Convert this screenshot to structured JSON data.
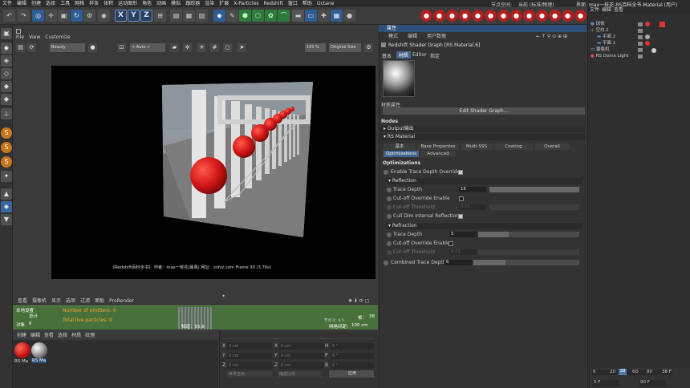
{
  "menu": [
    "文件",
    "编辑",
    "创建",
    "选择",
    "工具",
    "网格",
    "样条",
    "体积",
    "运动图形",
    "角色",
    "动画",
    "模拟",
    "跟踪器",
    "渲染",
    "扩展",
    "X-Particles",
    "Redshift",
    "窗口",
    "帮助",
    "Octane"
  ],
  "node_space_label": "节点空间:",
  "node_space_value": "当前 (标准/物理)",
  "interface_label": "界面:",
  "interface_value": "max一枝花-RS百科全书-Material (用户)",
  "xyz": [
    "X",
    "Y",
    "Z"
  ],
  "viewport": {
    "menu": [
      "查看",
      "摄像机",
      "显示",
      "选项",
      "过滤",
      "面板",
      "ProRender"
    ],
    "panel_menu": [
      "File",
      "View",
      "Customize"
    ],
    "preset": "Beauty",
    "mode": "< Auto >",
    "zoom": "100 %",
    "size": "Original Size",
    "status": "《Redshift百科全书》 作者：max一枝花(路禹) 网址：xshiz.com  Frame  30 (3.76s)"
  },
  "bottom_tabs": [
    "创建",
    "编辑",
    "查看",
    "选择",
    "材质",
    "纹理"
  ],
  "green": {
    "emitters": "Number of emitters: 0",
    "particles": "Total live particles: 0",
    "col1": "本地设置",
    "col2": "总计",
    "obj": "对象",
    "objval": "6",
    "frame": "帧：",
    "frameval": "38",
    "grid": "网格间距：",
    "gridval": "100 cm",
    "knot": "知道：55.6",
    "sub": "节点 0：6 5"
  },
  "materials": [
    {
      "name": "RS Ma",
      "color": "#e02020"
    },
    {
      "name": "RS Ma",
      "color": "#aaaaaa"
    }
  ],
  "coords": {
    "x": "X",
    "y": "Y",
    "z": "Z",
    "h": "H",
    "p": "P",
    "b": "B",
    "zero": "0 cm",
    "deg": "0 °",
    "world": "世界坐标",
    "scale": "缩放比例",
    "apply": "应用"
  },
  "attr": {
    "title": "属性",
    "menu": [
      "模式",
      "编辑",
      "用户数据"
    ],
    "object_name": "Redshift Shader Graph [RS Material.6]",
    "tabs": [
      "基本",
      "材质",
      "Editor",
      "指定"
    ],
    "mat_props": "材质属性",
    "edit_graph": "Edit Shader Graph...",
    "nodes": "Nodes",
    "output": "Output输出",
    "rs_material": "RS Material",
    "rs_tabs1": [
      "基本",
      "Base Properties",
      "Multi-SSS",
      "Coating",
      "Overall"
    ],
    "rs_tabs2": [
      "Optimizations",
      "Advanced"
    ],
    "optimizations": "Optimizations",
    "enable_trace": "Enable Trace Depth Overrides",
    "reflection": "Reflection",
    "trace_depth": "Trace Depth",
    "trace_refl": "16",
    "cutoff_enable": "Cut-off Override Enable",
    "cutoff_threshold": "Cut-off Threshold",
    "cutoff_val": "0.01",
    "cull": "Cull Dim Internal Reflections",
    "refraction": "Refraction",
    "trace_refr": "5",
    "combined": "Combined Trace Depth",
    "combined_val": "6",
    "refl_fill": 1.0,
    "refr_fill": 0.3,
    "comb_fill": 0.3
  },
  "obj": {
    "title": [
      "文件",
      "编辑",
      "查看"
    ],
    "menu": [
      "文件",
      "编辑",
      "查看"
    ],
    "items": [
      "球体",
      "空白.1",
      "平面.2",
      "平面.1",
      "摄像机",
      "RS Dome Light"
    ]
  },
  "timeline": {
    "t0": "0",
    "t20": "20",
    "t38": "38",
    "t60": "6D",
    "t80": "80",
    "cur": "38 F",
    "start": "0 F",
    "end": "90 F"
  },
  "accent": "#2d4f7a"
}
